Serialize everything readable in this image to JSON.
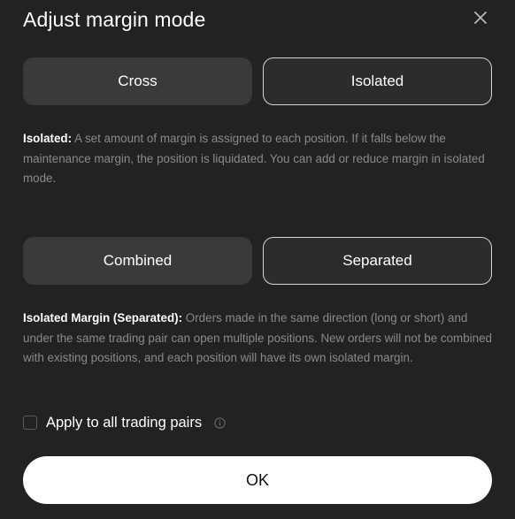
{
  "dialog": {
    "title": "Adjust margin mode",
    "close_icon": "close-icon"
  },
  "margin_type": {
    "options": [
      "Cross",
      "Isolated"
    ],
    "selected": "Isolated",
    "description_lead": "Isolated:",
    "description_text": "A set amount of margin is assigned to each position. If it falls below the maintenance margin, the position is liquidated. You can add or reduce margin in isolated mode."
  },
  "position_mode": {
    "options": [
      "Combined",
      "Separated"
    ],
    "selected": "Separated",
    "description_lead": "Isolated Margin (Separated):",
    "description_text": "Orders made in the same direction (long or short) and under the same trading pair can open multiple positions. New orders will not be combined with existing positions, and each position will have its own isolated margin."
  },
  "apply_all": {
    "label": "Apply to all trading pairs",
    "checked": false,
    "info_icon": "info-icon"
  },
  "ok_label": "OK",
  "colors": {
    "background": "#222222",
    "inactive_button": "#3a3a3a",
    "active_border": "#d6d6d6",
    "muted_text": "#8a8a8a",
    "primary_button": "#ffffff"
  }
}
